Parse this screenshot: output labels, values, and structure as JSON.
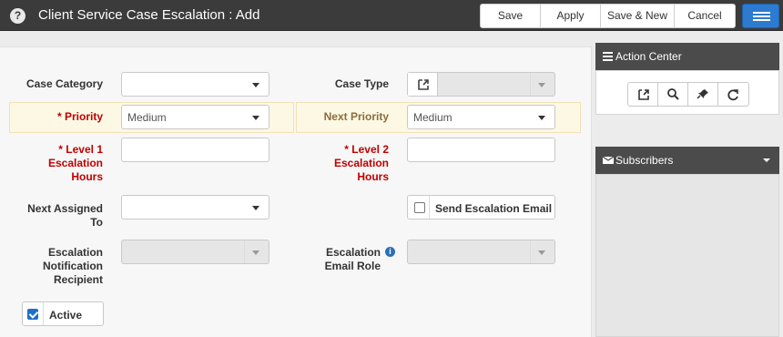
{
  "header": {
    "title": "Client Service Case Escalation : Add",
    "help_icon": "?",
    "buttons": [
      {
        "label": "Save"
      },
      {
        "label": "Apply"
      },
      {
        "label": "Save & New"
      },
      {
        "label": "Cancel"
      }
    ],
    "menu_icon": "hamburger-menu",
    "bg_color": "#3b3b3b",
    "accent_color": "#2d7bd0"
  },
  "form": {
    "case_category": {
      "label": "Case Category",
      "value": ""
    },
    "case_type": {
      "label": "Case Type",
      "value": ""
    },
    "priority": {
      "label": "* Priority",
      "value": "Medium"
    },
    "next_priority": {
      "label": "Next Priority",
      "value": "Medium"
    },
    "level1": {
      "label_lines": [
        "* Level 1",
        "Escalation",
        "Hours"
      ],
      "value": ""
    },
    "level2": {
      "label_lines": [
        "* Level 2",
        "Escalation",
        "Hours"
      ],
      "value": ""
    },
    "next_assigned": {
      "label_lines": [
        "Next Assigned",
        "To"
      ],
      "value": ""
    },
    "send_email": {
      "label": "Send Escalation Email",
      "checked": false
    },
    "notification_recipient": {
      "label_lines": [
        "Escalation",
        "Notification",
        "Recipient"
      ],
      "value": ""
    },
    "email_role": {
      "label_lines": [
        "Escalation",
        "Email Role"
      ],
      "value": ""
    },
    "active": {
      "label": "Active",
      "checked": true
    },
    "required_color": "#c00000",
    "highlight_color": "#fcf8e3"
  },
  "side": {
    "action_center": {
      "title": "Action Center",
      "icon": "list-icon",
      "tools": [
        "open-external-icon",
        "search-icon",
        "pin-icon",
        "refresh-icon"
      ]
    },
    "subscribers": {
      "title": "Subscribers",
      "icon": "envelope-icon"
    }
  }
}
